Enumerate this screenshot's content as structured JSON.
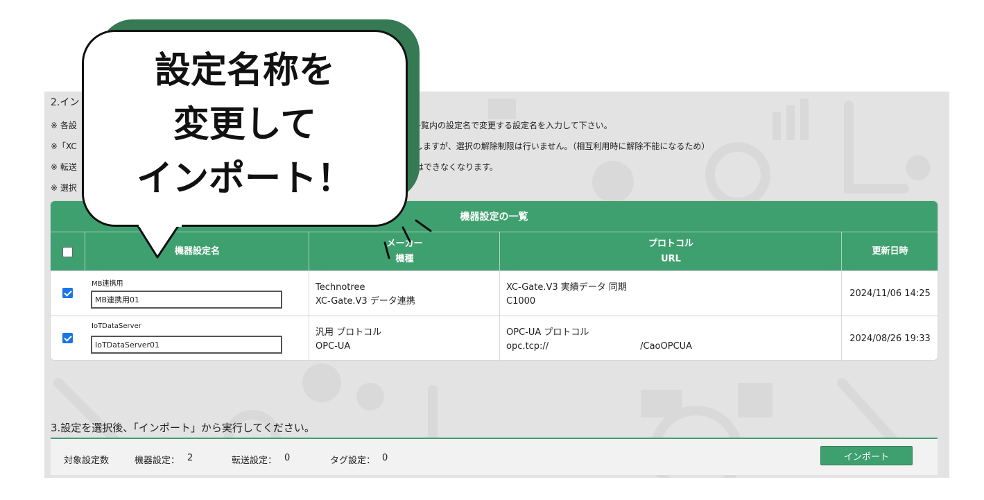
{
  "step2": {
    "title": "2.イン",
    "notes": [
      {
        "prefix": "※ 各設",
        "tail": "、一覧内の設定名で変更する設定名を入力して下さい。"
      },
      {
        "prefix": "※「XC",
        "tail": "択しますが、選択の解除制限は行いません。（相互利用時に解除不能になるため）"
      },
      {
        "prefix": "※ 転送",
        "tail": "除はできなくなります。"
      },
      {
        "prefix": "※ 選択",
        "tail": ""
      }
    ]
  },
  "callout": {
    "lines": [
      "設定名称を",
      "変更して",
      "インポート！"
    ]
  },
  "table": {
    "caption": "機器設定の一覧",
    "headers": {
      "name": "機器設定名",
      "maker": "メーカー",
      "model": "機種",
      "protocol": "プロトコル",
      "url": "URL",
      "updated": "更新日時"
    },
    "rows": [
      {
        "checked": true,
        "orig_name": "MB連携用",
        "name_value": "MB連携用01",
        "maker": "Technotree",
        "model": "XC-Gate.V3 データ連携",
        "protocol": "XC-Gate.V3 実績データ 同期",
        "url": "C1000",
        "updated": "2024/11/06 14:25"
      },
      {
        "checked": true,
        "orig_name": "IoTDataServer",
        "name_value": "IoTDataServer01",
        "maker": "汎用 プロトコル",
        "model": "OPC-UA",
        "protocol": "OPC-UA プロトコル",
        "url": "opc.tcp://",
        "url_suffix": "/CaoOPCUA",
        "updated": "2024/08/26 19:33"
      }
    ]
  },
  "step3": {
    "title": "3.設定を選択後、「インポート」から実行してください。"
  },
  "footer": {
    "label": "対象設定数",
    "device_label": "機器設定：",
    "device_count": "2",
    "transfer_label": "転送設定：",
    "transfer_count": "0",
    "tag_label": "タグ設定：",
    "tag_count": "0",
    "import_label": "インポート"
  },
  "colors": {
    "accent": "#3fa06f",
    "bubble_shadow": "#357a52",
    "panel_bg": "#e3e3e3",
    "checkbox": "#1a73e8"
  }
}
